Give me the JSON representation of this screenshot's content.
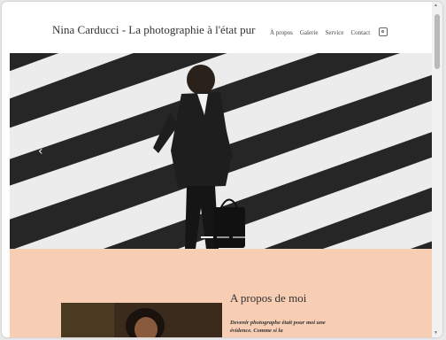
{
  "header": {
    "site_title": "Nina Carducci - La photographie à l'état pur",
    "nav": [
      {
        "label": "À propos"
      },
      {
        "label": "Galerie"
      },
      {
        "label": "Service"
      },
      {
        "label": "Contact"
      }
    ],
    "instagram_icon": "instagram-icon"
  },
  "hero": {
    "prev_arrow": "‹",
    "slide_count": 3,
    "active_slide": 1
  },
  "about": {
    "title": "A propos de moi",
    "text": "Devenir photographe était pour moi une évidence. Comme si la"
  },
  "colors": {
    "about_bg": "#f7cdb4",
    "hero_dark": "#2b2b2b",
    "stripes": "#ececec"
  }
}
